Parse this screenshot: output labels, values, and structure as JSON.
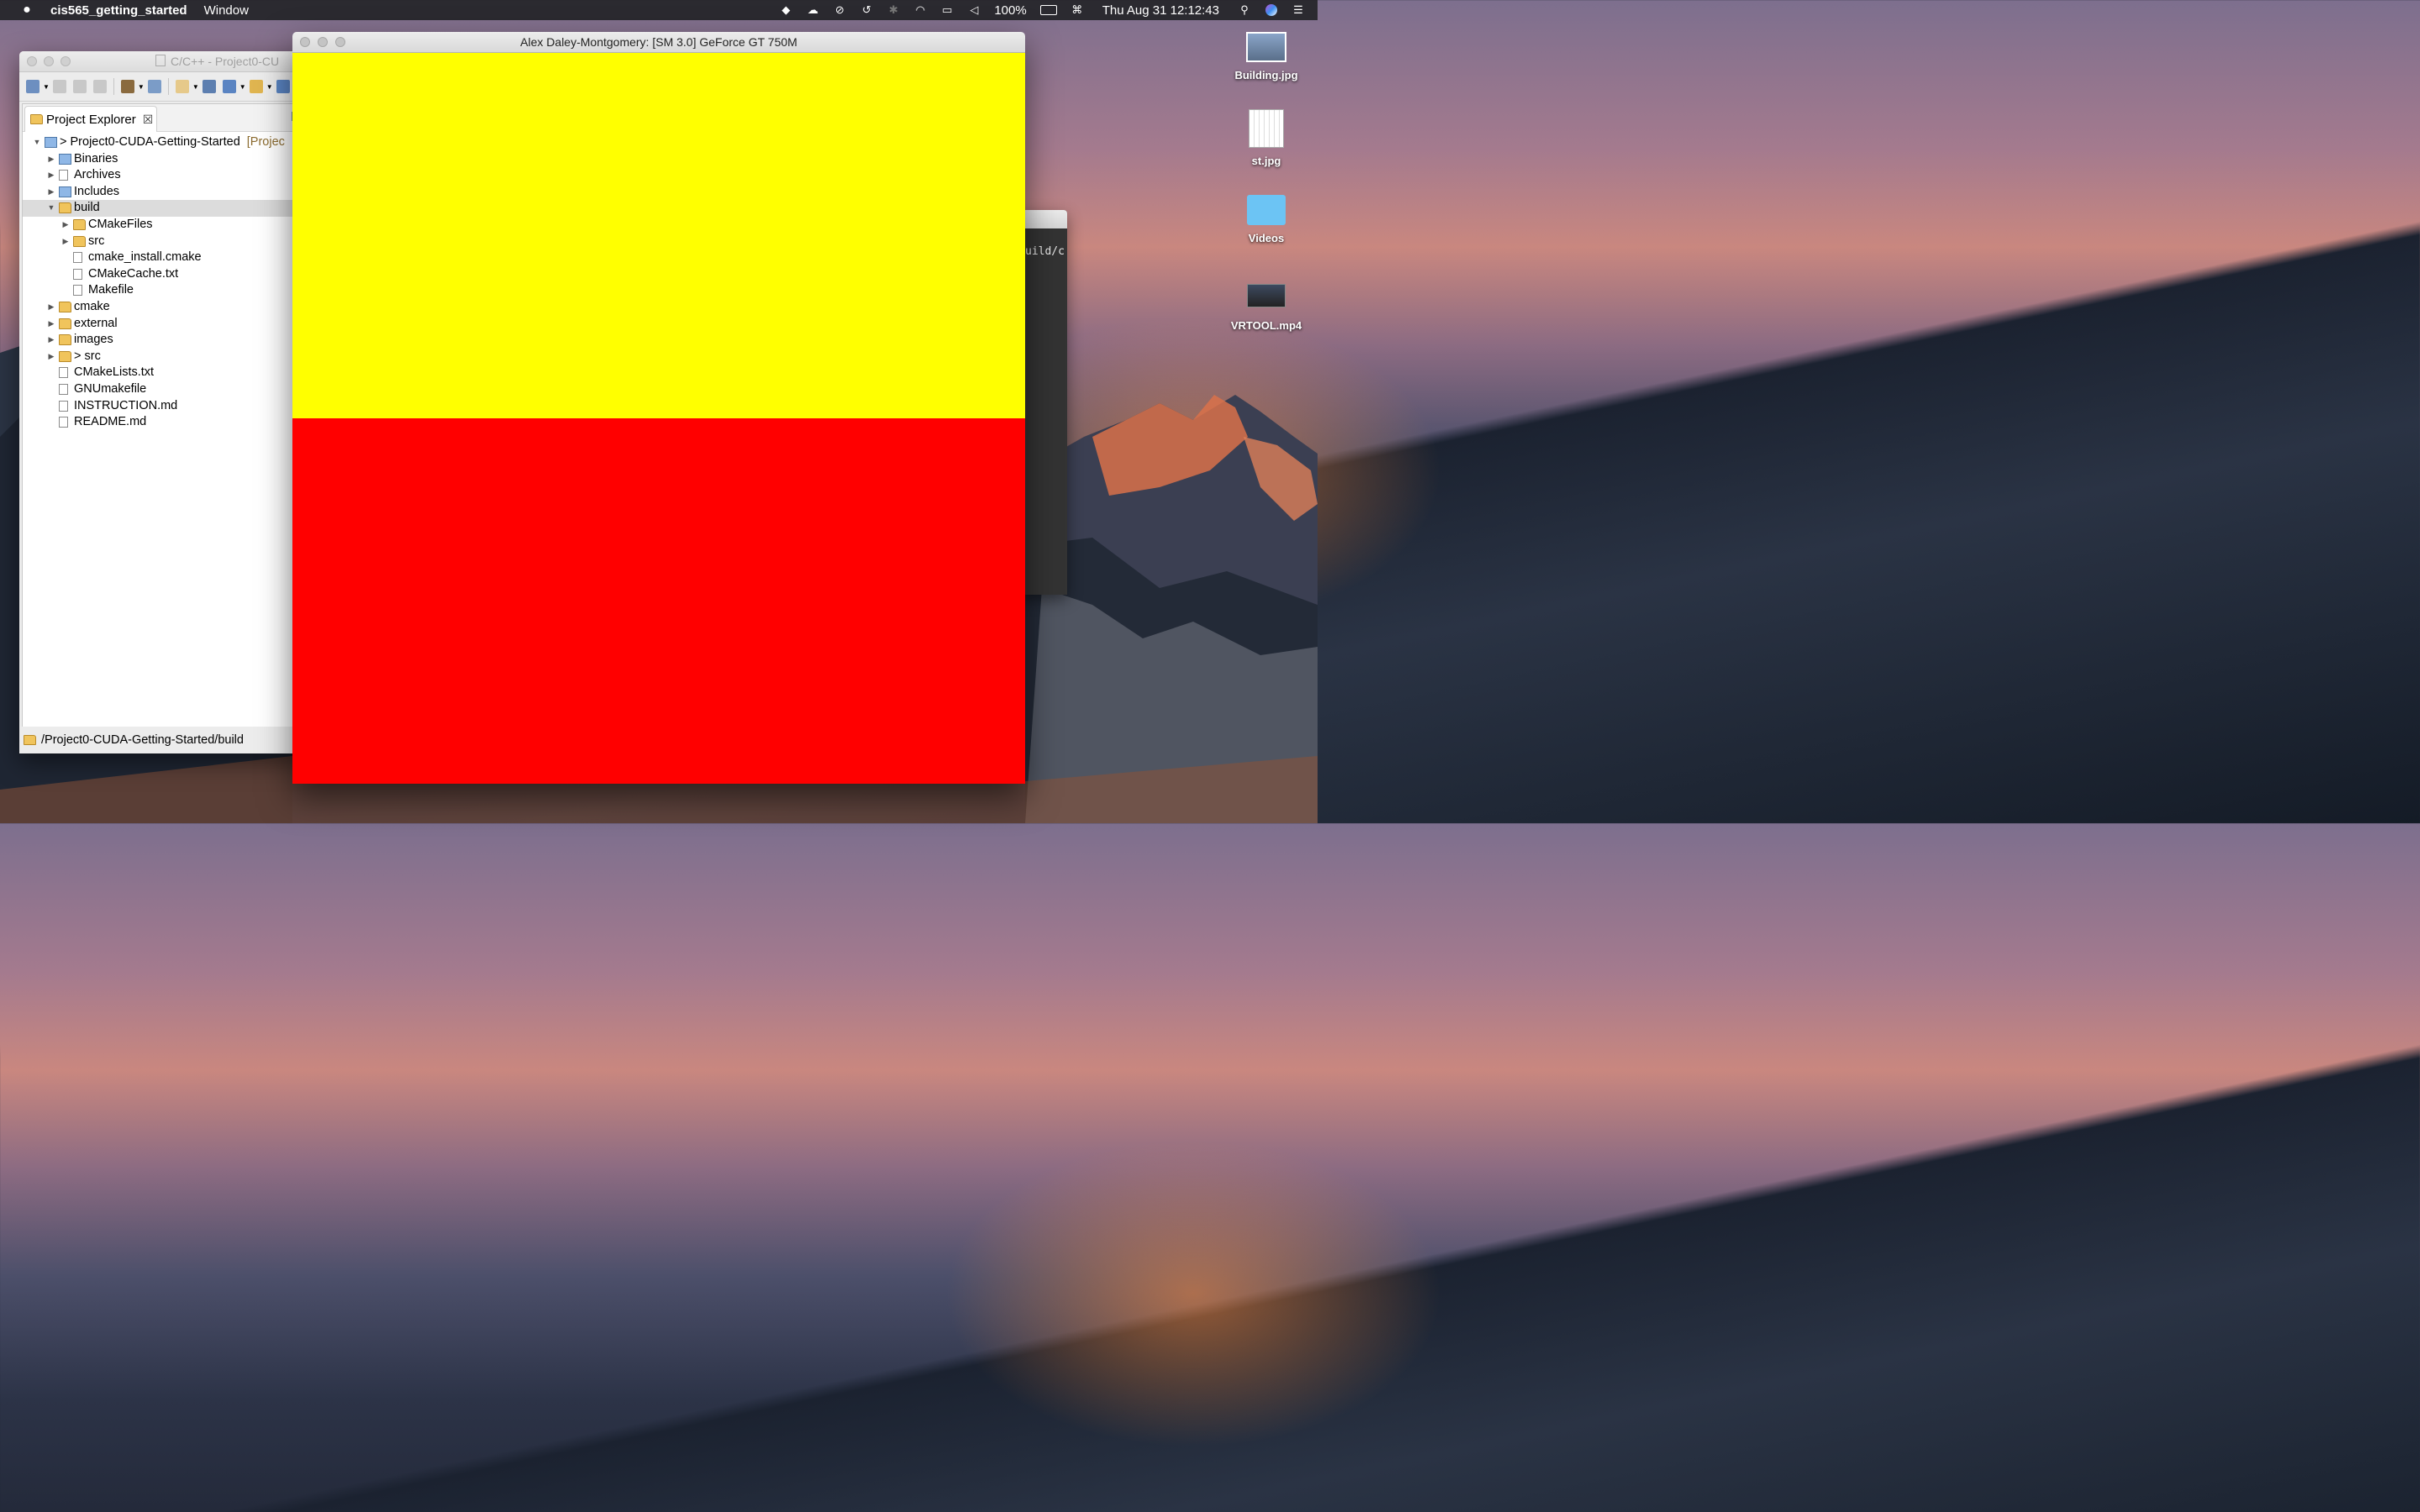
{
  "menubar": {
    "apple_icon": "apple-icon",
    "app_name": "cis565_getting_started",
    "menus": [
      "Window"
    ],
    "status_icons": [
      "dropbox-icon",
      "creative-cloud-icon",
      "sync-icon",
      "time-machine-icon",
      "bluetooth-icon",
      "wifi-icon",
      "airplay-icon",
      "volume-icon"
    ],
    "battery_percent": "100%",
    "datetime": "Thu Aug 31  12:12:43",
    "right_icons": [
      "keyboard-icon",
      "spotlight-icon",
      "siri-icon",
      "notification-center-icon"
    ]
  },
  "eclipse": {
    "title": "C/C++ - Project0-CU",
    "panel_tab": "Project Explorer",
    "tree": [
      {
        "label": "Project0-CUDA-Getting-Started",
        "prefix": ">",
        "decoration": "[Projec",
        "depth": 0,
        "expanded": true,
        "icon": "project"
      },
      {
        "label": "Binaries",
        "depth": 1,
        "expanded": false,
        "icon": "binaries"
      },
      {
        "label": "Archives",
        "depth": 1,
        "expanded": false,
        "icon": "archives"
      },
      {
        "label": "Includes",
        "depth": 1,
        "expanded": false,
        "icon": "includes"
      },
      {
        "label": "build",
        "depth": 1,
        "expanded": true,
        "icon": "folder",
        "selected": true
      },
      {
        "label": "CMakeFiles",
        "depth": 2,
        "expanded": false,
        "icon": "folder"
      },
      {
        "label": "src",
        "depth": 2,
        "expanded": false,
        "icon": "folder"
      },
      {
        "label": "cmake_install.cmake",
        "depth": 2,
        "icon": "file"
      },
      {
        "label": "CMakeCache.txt",
        "depth": 2,
        "icon": "file"
      },
      {
        "label": "Makefile",
        "depth": 2,
        "icon": "makefile"
      },
      {
        "label": "cmake",
        "depth": 1,
        "expanded": false,
        "icon": "folder"
      },
      {
        "label": "external",
        "depth": 1,
        "expanded": false,
        "icon": "folder"
      },
      {
        "label": "images",
        "depth": 1,
        "expanded": false,
        "icon": "folder"
      },
      {
        "label": "src",
        "prefix": ">",
        "depth": 1,
        "expanded": false,
        "icon": "folder"
      },
      {
        "label": "CMakeLists.txt",
        "depth": 1,
        "icon": "file"
      },
      {
        "label": "GNUmakefile",
        "depth": 1,
        "icon": "makefile"
      },
      {
        "label": "INSTRUCTION.md",
        "depth": 1,
        "icon": "file"
      },
      {
        "label": "README.md",
        "depth": 1,
        "icon": "file"
      }
    ],
    "status_path": "/Project0-CUDA-Getting-Started/build"
  },
  "terminal": {
    "visible_text": "uild/c"
  },
  "cuda_window": {
    "title": "Alex Daley-Montgomery: [SM 3.0] GeForce GT 750M",
    "top_color": "#ffff00",
    "bottom_color": "#ff0000"
  },
  "desktop_icons": [
    {
      "label": "Building.jpg",
      "type": "image"
    },
    {
      "label": "st.jpg",
      "type": "image"
    },
    {
      "label": "Videos",
      "type": "folder"
    },
    {
      "label": "VRTOOL.mp4",
      "type": "video"
    }
  ]
}
